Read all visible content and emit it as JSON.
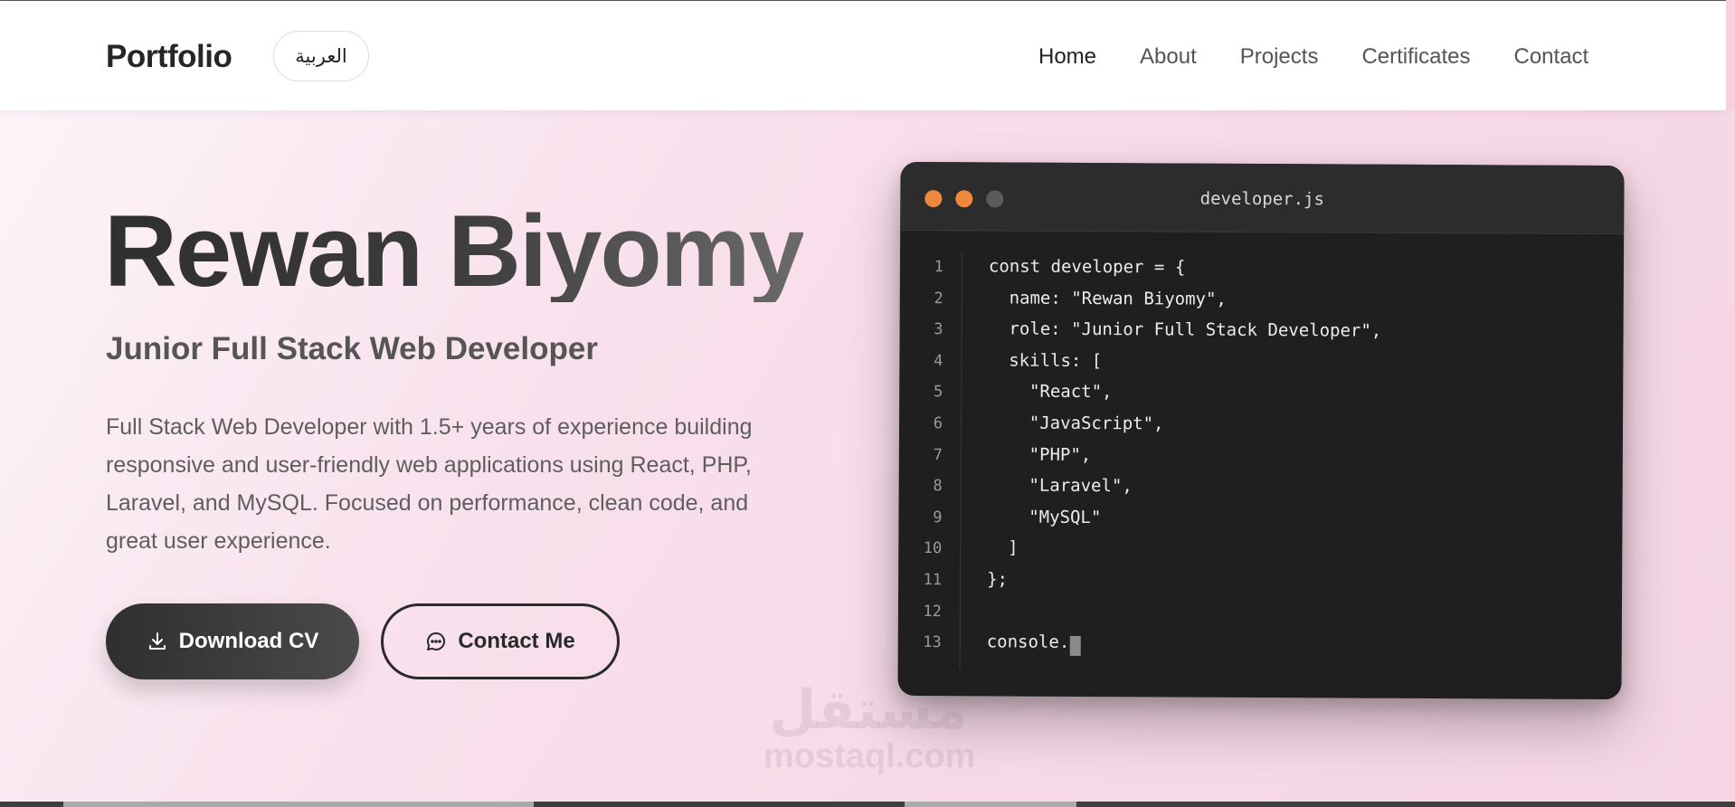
{
  "header": {
    "logo": "Portfolio",
    "lang_toggle": "العربية",
    "nav": [
      {
        "label": "Home",
        "active": true
      },
      {
        "label": "About",
        "active": false
      },
      {
        "label": "Projects",
        "active": false
      },
      {
        "label": "Certificates",
        "active": false
      },
      {
        "label": "Contact",
        "active": false
      }
    ]
  },
  "hero": {
    "name": "Rewan Biyomy",
    "subtitle": "Junior Full Stack Web Developer",
    "description": "Full Stack Web Developer with 1.5+ years of experience building responsive and user-friendly web applications using React, PHP, Laravel, and MySQL. Focused on performance, clean code, and great user experience.",
    "download_label": "Download CV",
    "download_icon": "download-icon",
    "contact_label": "Contact Me",
    "contact_icon": "chat-bubble-icon"
  },
  "editor": {
    "filename": "developer.js",
    "lines": [
      {
        "n": "1",
        "text": "const developer = {"
      },
      {
        "n": "2",
        "text": "  name: \"Rewan Biyomy\","
      },
      {
        "n": "3",
        "text": "  role: \"Junior Full Stack Developer\","
      },
      {
        "n": "4",
        "text": "  skills: ["
      },
      {
        "n": "5",
        "text": "    \"React\","
      },
      {
        "n": "6",
        "text": "    \"JavaScript\","
      },
      {
        "n": "7",
        "text": "    \"PHP\","
      },
      {
        "n": "8",
        "text": "    \"Laravel\","
      },
      {
        "n": "9",
        "text": "    \"MySQL\""
      },
      {
        "n": "10",
        "text": "  ]"
      },
      {
        "n": "11",
        "text": "};"
      },
      {
        "n": "12",
        "text": ""
      },
      {
        "n": "13",
        "text": "console."
      }
    ],
    "dot_colors": [
      "#f0873e",
      "#f0873e",
      "#5b5b5b"
    ]
  },
  "watermark": {
    "arabic": "مستقل",
    "latin": "mostaql.com"
  },
  "colors": {
    "accent_dark": "#2f2f2f",
    "background_pink": "#f7d9e7",
    "editor_bg": "#1f1f1f"
  }
}
